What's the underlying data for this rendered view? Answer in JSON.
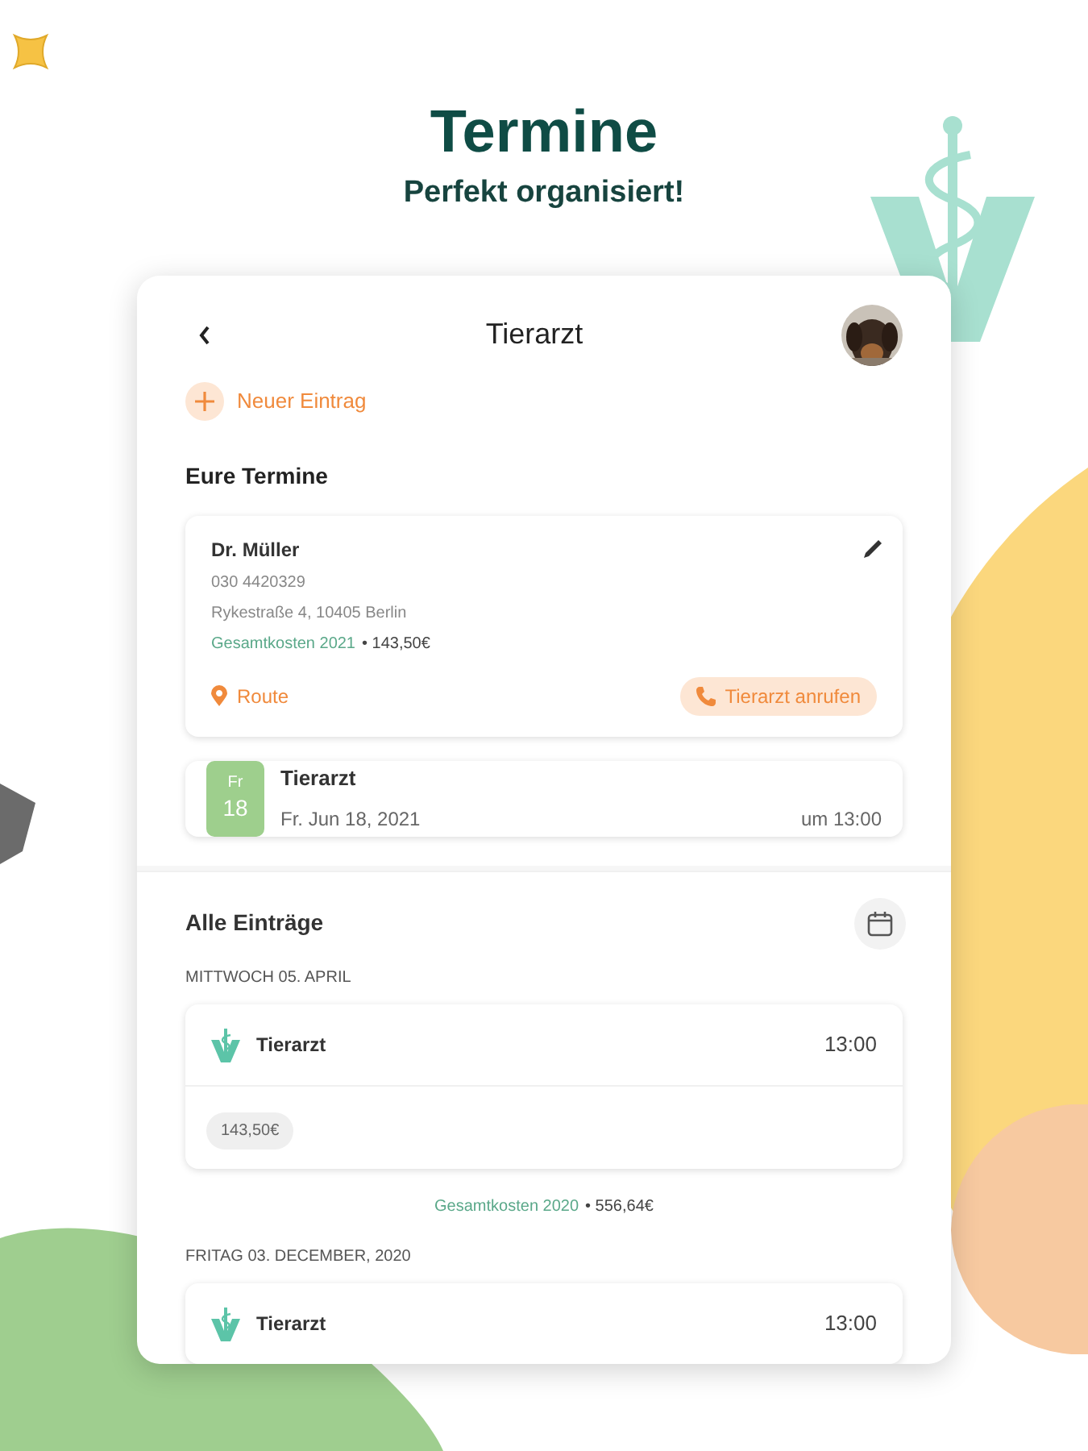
{
  "headline": {
    "title": "Termine",
    "subtitle": "Perfekt organisiert!"
  },
  "screen": {
    "title": "Tierarzt",
    "new_entry": "Neuer Eintrag",
    "section_title": "Eure Termine",
    "vet_card": {
      "name": "Dr. Müller",
      "phone": "030 4420329",
      "address": "Rykestraße 4, 10405 Berlin",
      "costs_label": "Gesamtkosten 2021",
      "costs_value": "• 143,50€",
      "route": "Route",
      "call": "Tierarzt anrufen"
    },
    "next_appointment": {
      "weekday": "Fr",
      "day": "18",
      "title": "Tierarzt",
      "date": "Fr. Jun 18, 2021",
      "time": "um 13:00"
    },
    "all_entries_title": "Alle Einträge",
    "entries": [
      {
        "kind": "date",
        "label": "MITTWOCH 05. APRIL"
      },
      {
        "kind": "entry",
        "title": "Tierarzt",
        "time": "13:00",
        "price": "143,50€"
      },
      {
        "kind": "total",
        "label": "Gesamtkosten 2020",
        "value": "• 556,64€"
      },
      {
        "kind": "date",
        "label": "FRITAG 03. DECEMBER, 2020"
      },
      {
        "kind": "entry",
        "title": "Tierarzt",
        "time": "13:00"
      }
    ]
  }
}
